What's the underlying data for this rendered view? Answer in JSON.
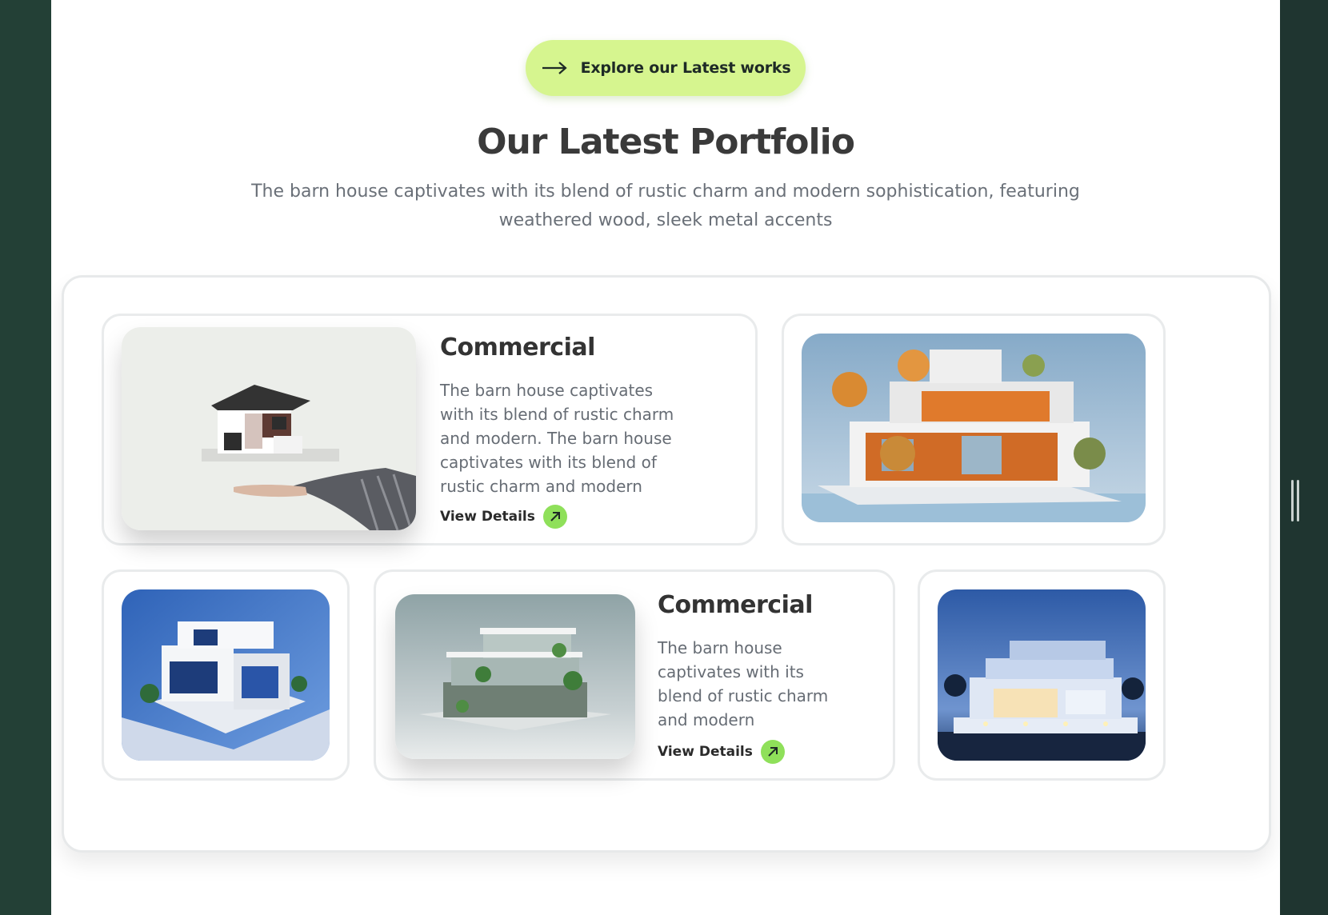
{
  "hero": {
    "cta_label": "Explore our Latest works",
    "title": "Our Latest Portfolio",
    "subtitle": "The barn house captivates with its blend of rustic charm and modern sophistication, featuring weathered wood, sleek metal accents"
  },
  "portfolio": {
    "card1": {
      "title": "Commercial",
      "description": "The barn house captivates with its blend of rustic charm and modern. The barn house captivates with its blend of rustic charm and modern",
      "details_label": "View Details"
    },
    "card4": {
      "title": "Commercial",
      "description": "The barn house captivates with its blend of rustic charm and modern",
      "details_label": "View Details"
    }
  },
  "icons": {
    "cta": "arrow-right-icon",
    "details": "arrow-up-right-icon"
  },
  "colors": {
    "accent": "#d6f58f",
    "details_badge": "#8fe05a",
    "frame": "#234036",
    "heading": "#3a3a3a"
  }
}
